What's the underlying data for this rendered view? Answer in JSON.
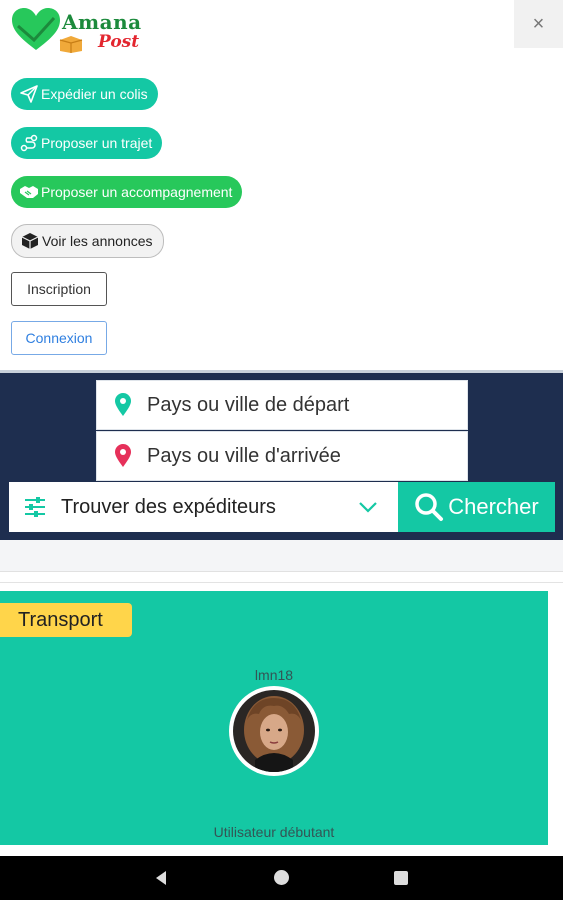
{
  "header": {
    "logo_line1": "Amana",
    "logo_line2": "Post",
    "close_icon": "×"
  },
  "menu": {
    "items": [
      {
        "label": "Expédier un colis",
        "icon": "paper-plane-icon"
      },
      {
        "label": "Proposer un trajet",
        "icon": "route-icon"
      },
      {
        "label": "Proposer un accompagnement",
        "icon": "handshake-icon"
      },
      {
        "label": "Voir les annonces",
        "icon": "box-icon"
      }
    ],
    "signup_label": "Inscription",
    "login_label": "Connexion"
  },
  "search": {
    "departure_placeholder": "Pays ou ville de départ",
    "arrival_placeholder": "Pays ou ville d'arrivée",
    "type_selected": "Trouver des expéditeurs",
    "search_label": "Chercher"
  },
  "colors": {
    "teal": "#14c8a4",
    "green": "#27c85b",
    "navy": "#1e2e4f",
    "tag_yellow": "#ffd54a",
    "pin_arrival": "#e6305a"
  },
  "card": {
    "tag": "Transport",
    "username": "lmn18",
    "level": "Utilisateur débutant"
  }
}
